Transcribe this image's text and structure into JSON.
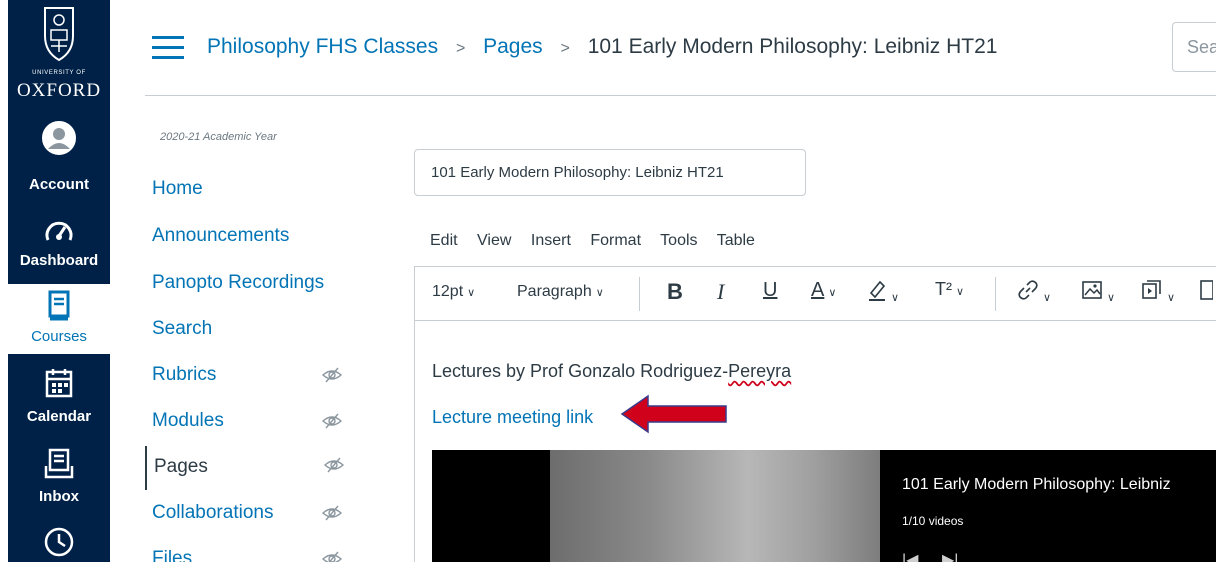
{
  "global_nav": {
    "logo": {
      "line1": "UNIVERSITY OF",
      "line2": "OXFORD"
    },
    "items": [
      {
        "label": "Account",
        "icon": "user-avatar-icon"
      },
      {
        "label": "Dashboard",
        "icon": "dashboard-gauge-icon"
      },
      {
        "label": "Courses",
        "icon": "courses-book-icon",
        "active": true
      },
      {
        "label": "Calendar",
        "icon": "calendar-icon"
      },
      {
        "label": "Inbox",
        "icon": "inbox-icon"
      },
      {
        "label": "",
        "icon": "clock-history-icon"
      }
    ]
  },
  "header": {
    "breadcrumbs": [
      "Philosophy FHS Classes",
      "Pages",
      "101 Early Modern Philosophy: Leibniz HT21"
    ],
    "separator": ">",
    "search_placeholder": "Sea"
  },
  "course_nav": {
    "academic_year": "2020-21 Academic Year",
    "items": [
      {
        "label": "Home",
        "hidden": false
      },
      {
        "label": "Announcements",
        "hidden": false
      },
      {
        "label": "Panopto Recordings",
        "hidden": false
      },
      {
        "label": "Search",
        "hidden": false
      },
      {
        "label": "Rubrics",
        "hidden": true
      },
      {
        "label": "Modules",
        "hidden": true
      },
      {
        "label": "Pages",
        "hidden": true,
        "current": true
      },
      {
        "label": "Collaborations",
        "hidden": true
      },
      {
        "label": "Files",
        "hidden": true
      }
    ]
  },
  "editor": {
    "title_value": "101 Early Modern Philosophy: Leibniz HT21",
    "menus": [
      "Edit",
      "View",
      "Insert",
      "Format",
      "Tools",
      "Table"
    ],
    "toolbar": {
      "font_size": "12pt",
      "block_format": "Paragraph",
      "bold": "B",
      "italic": "I",
      "underline": "U",
      "text_color": "A",
      "superscript": "T²"
    },
    "content": {
      "intro_prefix": "Lectures by Prof Gonzalo Rodriguez-",
      "intro_misspelled": "Pereyra",
      "link_text": "Lecture meeting link"
    },
    "video": {
      "playlist_title": "101 Early Modern Philosophy: Leibniz",
      "playlist_count": "1/10 videos"
    }
  },
  "colors": {
    "nav_bg": "#002147",
    "link": "#0374b5",
    "text": "#2d3b45",
    "annotation_arrow": "#d0021b"
  }
}
